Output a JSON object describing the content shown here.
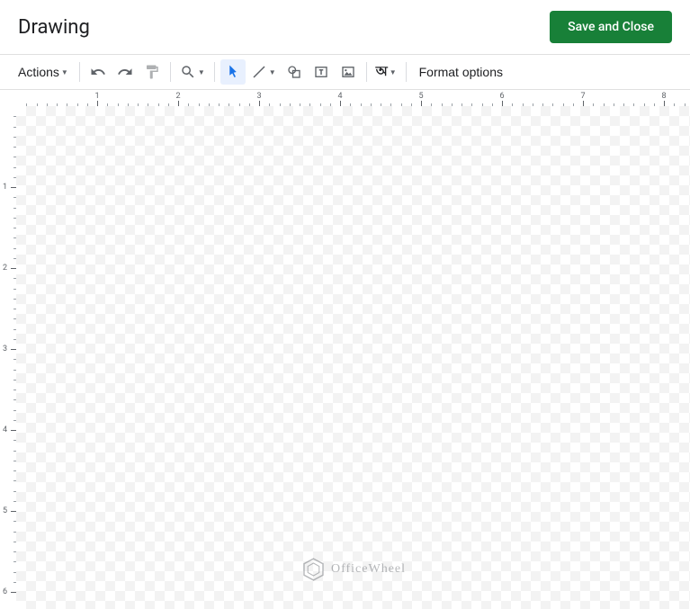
{
  "header": {
    "title": "Drawing",
    "save_label": "Save and Close"
  },
  "toolbar": {
    "actions_label": "Actions",
    "format_label": "Format options",
    "wordart_label": "অ"
  },
  "ruler": {
    "h_ticks": [
      1,
      2,
      3,
      4,
      5,
      6,
      7,
      8
    ],
    "v_ticks": [
      1,
      2,
      3,
      4,
      5,
      6
    ]
  },
  "watermark": {
    "text": "OfficeWheel"
  }
}
